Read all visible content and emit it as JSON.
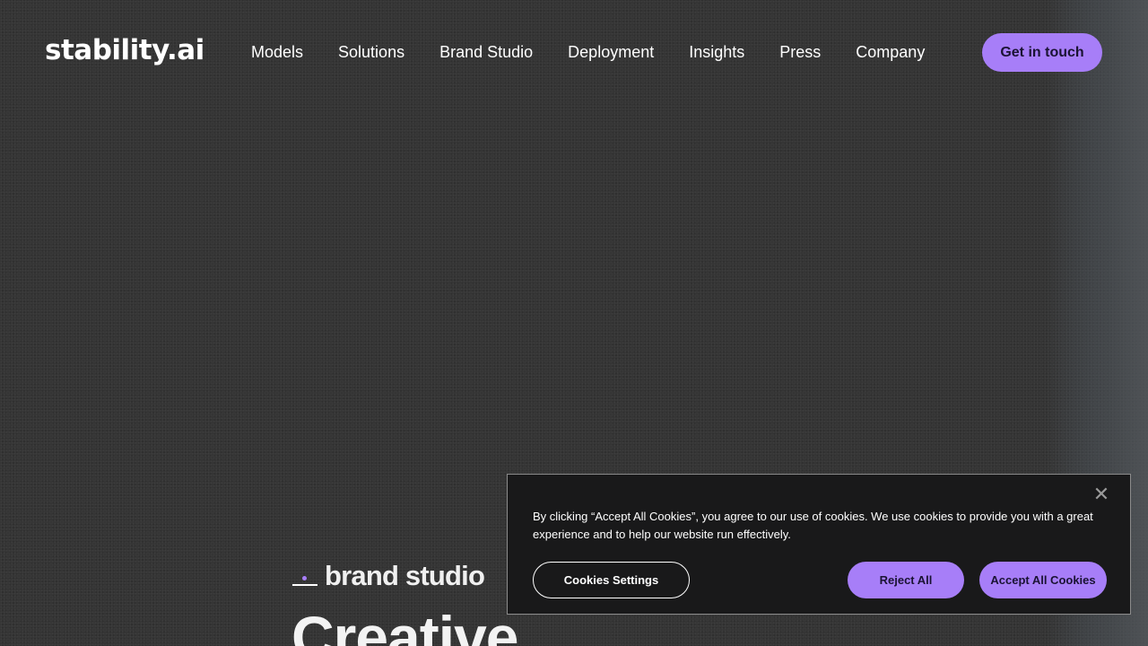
{
  "header": {
    "logo_text": "stability.ai",
    "nav": [
      {
        "label": "Models"
      },
      {
        "label": "Solutions"
      },
      {
        "label": "Brand Studio"
      },
      {
        "label": "Deployment"
      },
      {
        "label": "Insights"
      },
      {
        "label": "Press"
      },
      {
        "label": "Company"
      }
    ],
    "cta_label": "Get in touch"
  },
  "hero": {
    "brand_label": "brand studio",
    "title": "Creative"
  },
  "cookie_banner": {
    "close_icon": "close-icon",
    "text": "By clicking “Accept All Cookies”, you agree to our use of cookies. We use cookies to provide you with a great experience and to help our website run effectively.",
    "settings_label": "Cookies Settings",
    "reject_label": "Reject All",
    "accept_label": "Accept All Cookies"
  },
  "colors": {
    "accent": "#a77ef8",
    "background": "#323232",
    "panel": "#19191a"
  }
}
